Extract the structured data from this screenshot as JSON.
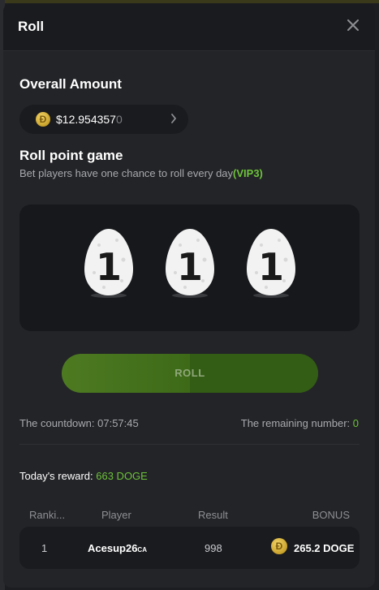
{
  "modal": {
    "title": "Roll"
  },
  "overall": {
    "heading": "Overall Amount",
    "amount_main": "$12.954357",
    "amount_dim": "0",
    "coin_symbol": "Ð"
  },
  "game": {
    "heading": "Roll point game",
    "subtitle": "Bet players have one chance to roll every day",
    "vip": "(VIP3)",
    "dice": [
      "1",
      "1",
      "1"
    ]
  },
  "roll_button": {
    "label": "ROLL"
  },
  "status": {
    "countdown_label": "The countdown: ",
    "countdown_value": "07:57:45",
    "remaining_label": "The remaining number: ",
    "remaining_value": "0"
  },
  "reward": {
    "label": "Today's reward: ",
    "value": "663 DOGE"
  },
  "table": {
    "headers": [
      "Ranki...",
      "Player",
      "Result",
      "BONUS"
    ],
    "rows": [
      {
        "rank": "1",
        "player": "Acesup26",
        "player_tag": "CA",
        "result": "998",
        "bonus": "265.2 DOGE"
      }
    ]
  },
  "colors": {
    "accent_green": "#6cc33a",
    "background": "#232427",
    "panel": "#17181b"
  }
}
